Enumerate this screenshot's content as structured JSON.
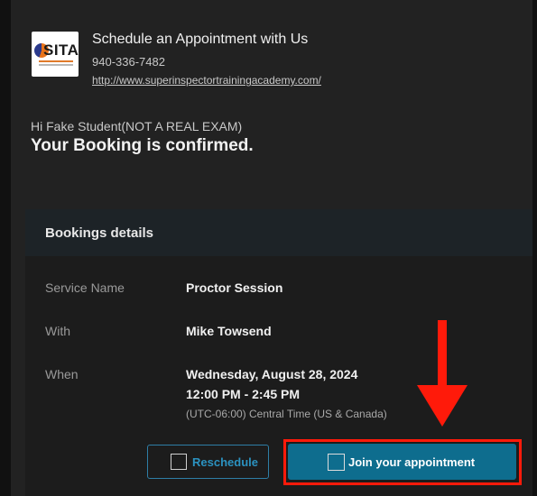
{
  "header": {
    "logo_text": "SITA",
    "title": "Schedule an Appointment with Us",
    "phone": "940-336-7482",
    "website": "http://www.superinspectortrainingacademy.com/"
  },
  "greeting": "Hi Fake Student(NOT A REAL EXAM)",
  "confirmation": "Your Booking is confirmed.",
  "details": {
    "title": "Bookings details",
    "rows": [
      {
        "label": "Service Name",
        "value": "Proctor Session"
      },
      {
        "label": "With",
        "value": "Mike Towsend"
      },
      {
        "label": "When",
        "value": "Wednesday, August 28, 2024",
        "time": "12:00 PM - 2:45 PM",
        "timezone": "(UTC-06:00) Central Time (US & Canada)"
      }
    ]
  },
  "actions": {
    "reschedule_label": "Reschedule",
    "join_label": "Join your appointment"
  },
  "colors": {
    "accent": "#0e6d8e",
    "link_accent": "#2b92c0",
    "annotation_red": "#ff1a0a"
  },
  "annotation": {
    "icon": "red-down-arrow-icon"
  }
}
